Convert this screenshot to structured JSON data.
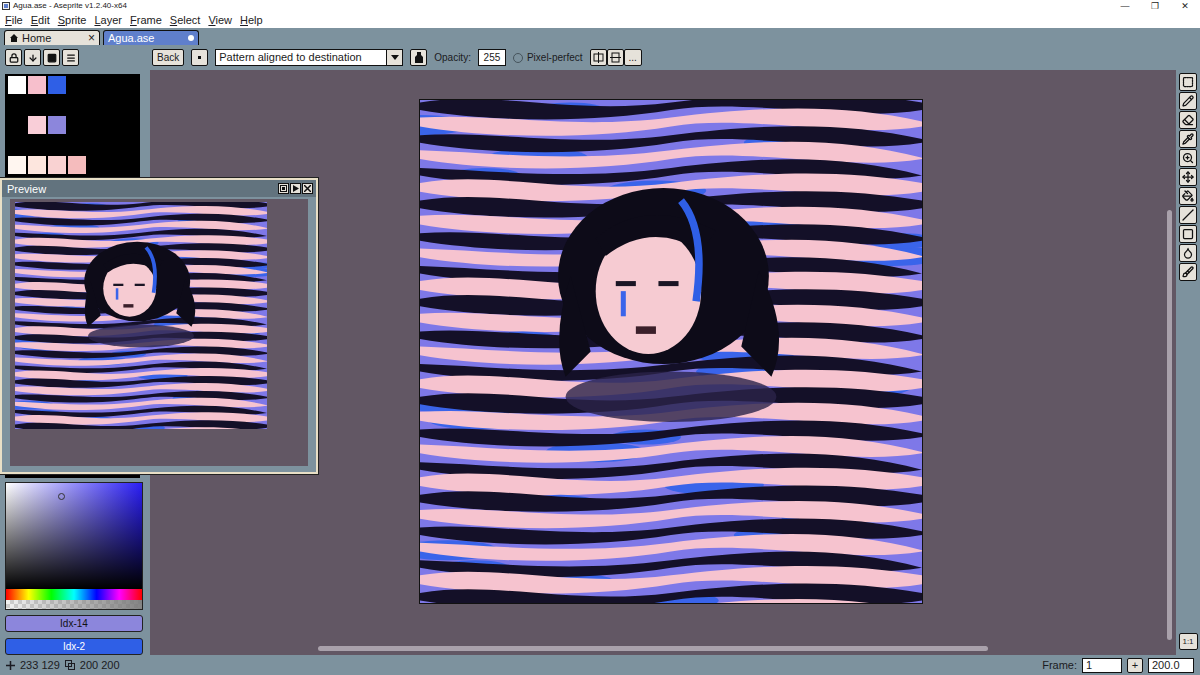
{
  "window": {
    "title": "Agua.ase - Aseprite v1.2.40-x64",
    "controls": [
      "—",
      "❐",
      "✕"
    ]
  },
  "menu": [
    "File",
    "Edit",
    "Sprite",
    "Layer",
    "Frame",
    "Select",
    "View",
    "Help"
  ],
  "tabs": [
    {
      "label": "Home",
      "selected": false,
      "modified": false,
      "close": "×"
    },
    {
      "label": "Agua.ase",
      "selected": true,
      "modified": true
    }
  ],
  "context_bar": {
    "back": "Back",
    "pattern": "Pattern aligned to destination",
    "opacity_label": "Opacity:",
    "opacity": "255",
    "pixel_perfect": {
      "label": "Pixel-perfect",
      "checked": false
    },
    "more": "..."
  },
  "palette": {
    "colors": [
      "#ffffff",
      "#f7bfcc",
      "#2f5fe6",
      "#000000",
      "#000000",
      "#000000",
      "#000000",
      "#000000",
      "#000000",
      "#f9ced8",
      "#8c86dc",
      "#000000",
      "#000000",
      "#000000",
      "#000000",
      "#000000",
      "#fff6f0",
      "#fde6de",
      "#f9d2d2",
      "#f5bcbd"
    ]
  },
  "preview": {
    "title": "Preview"
  },
  "colors": {
    "foreground": {
      "label": "Idx-14",
      "color": "#8c86dc"
    },
    "background": {
      "label": "Idx-2",
      "color": "#2f5fe6"
    }
  },
  "zoom_button": "1:1",
  "status_bar": {
    "position": "233 129",
    "size": "200 200",
    "frame_label": "Frame:",
    "frame": "1",
    "add_frame": "+",
    "zoom": "200.0"
  }
}
